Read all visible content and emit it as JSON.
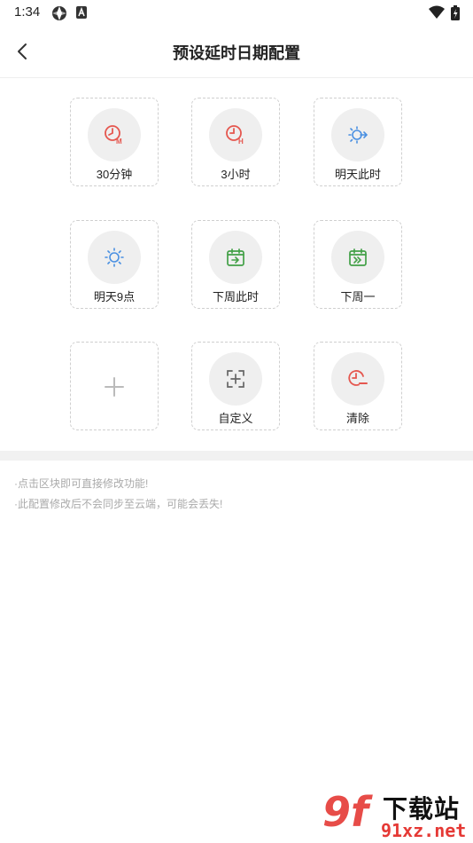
{
  "status_bar": {
    "time": "1:34"
  },
  "header": {
    "title": "预设延时日期配置"
  },
  "tiles": [
    {
      "label": "30分钟",
      "icon": "clock-m-icon",
      "color": "#e5574f"
    },
    {
      "label": "3小时",
      "icon": "clock-h-icon",
      "color": "#e5574f"
    },
    {
      "label": "明天此时",
      "icon": "sun-arrow-icon",
      "color": "#4a90e2"
    },
    {
      "label": "明天9点",
      "icon": "sun-icon",
      "color": "#4a90e2"
    },
    {
      "label": "下周此时",
      "icon": "calendar-arrow-icon",
      "color": "#43a047"
    },
    {
      "label": "下周一",
      "icon": "calendar-forward-icon",
      "color": "#43a047"
    },
    {
      "label": "",
      "icon": "plus-icon",
      "color": "#bbbbbb"
    },
    {
      "label": "自定义",
      "icon": "custom-add-icon",
      "color": "#666666"
    },
    {
      "label": "清除",
      "icon": "clock-clear-icon",
      "color": "#e5574f"
    }
  ],
  "hints": [
    "·点击区块即可直接修改功能!",
    "·此配置修改后不会同步至云端，可能会丢失!"
  ],
  "watermark": {
    "logo": "9f",
    "title": "下载站",
    "url": "91xz.net"
  }
}
